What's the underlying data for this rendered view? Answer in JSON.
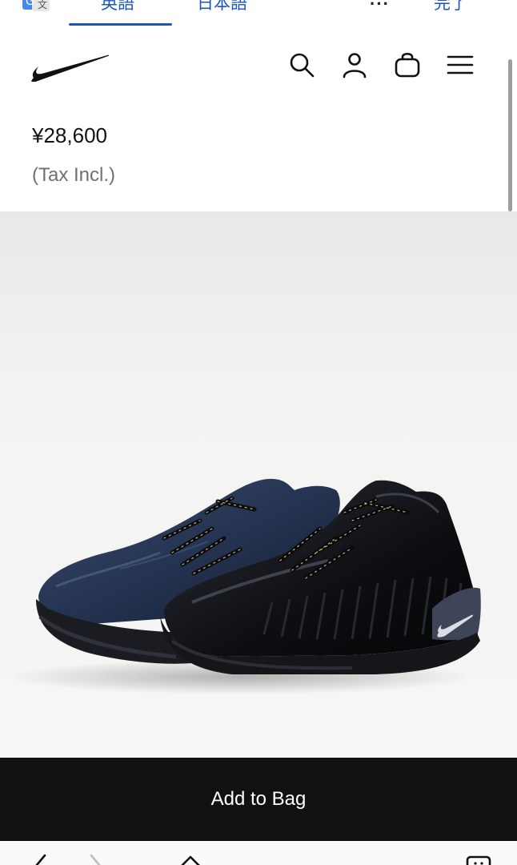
{
  "translate_bar": {
    "tab_english": "英語",
    "tab_japanese": "日本語",
    "more": "···",
    "done": "完了"
  },
  "header": {
    "logo": "nike-swoosh",
    "icons": [
      "search-icon",
      "account-icon",
      "bag-icon",
      "menu-icon"
    ]
  },
  "product": {
    "price": "¥28,600",
    "tax_note": "(Tax Incl.)",
    "image_alt": "black and navy low-top basketball shoes"
  },
  "actions": {
    "add_to_bag": "Add to Bag"
  },
  "browser_toolbar": {
    "icons": [
      "back-icon",
      "forward-icon",
      "home-icon",
      "tabs-icon"
    ]
  },
  "colors": {
    "accent_blue": "#1a55c0",
    "button_black": "#111111",
    "muted_text": "#707072"
  }
}
